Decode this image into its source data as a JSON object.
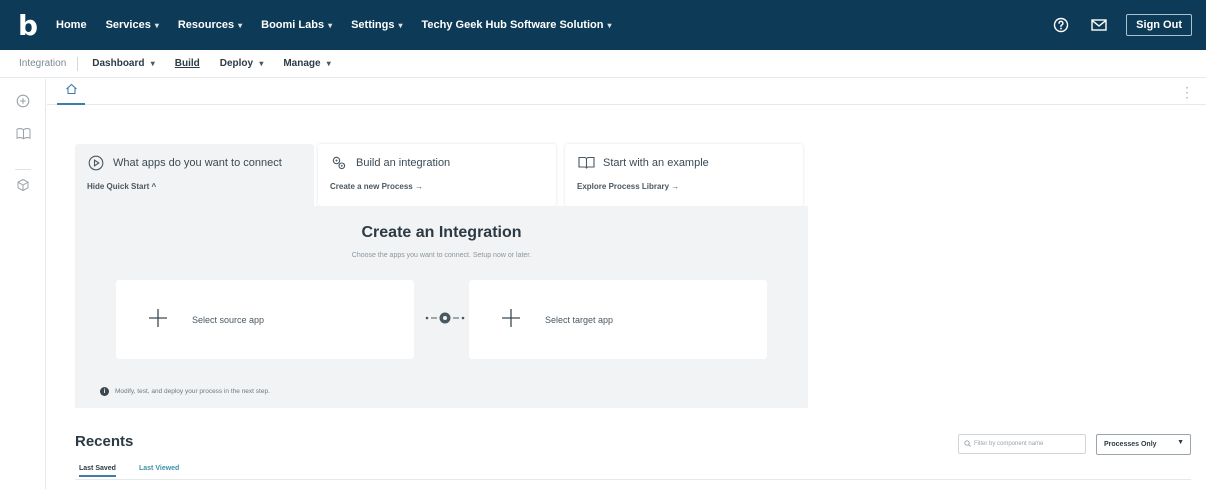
{
  "topnav": {
    "logo": "b",
    "items": [
      {
        "label": "Home",
        "caret": false
      },
      {
        "label": "Services",
        "caret": true
      },
      {
        "label": "Resources",
        "caret": true
      },
      {
        "label": "Boomi Labs",
        "caret": true
      },
      {
        "label": "Settings",
        "caret": true
      },
      {
        "label": "Techy Geek Hub Software Solution",
        "caret": true
      }
    ],
    "help_icon": "question-circle-icon",
    "mail_icon": "mail-icon",
    "signout_label": "Sign Out",
    "bg_color": "#0d3a56"
  },
  "subnav": {
    "title": "Integration",
    "items": [
      {
        "label": "Dashboard",
        "caret": true
      },
      {
        "label": "Build",
        "caret": false
      },
      {
        "label": "Deploy",
        "caret": true
      },
      {
        "label": "Manage",
        "caret": true
      }
    ]
  },
  "leftrail": {
    "icons": [
      "add-circle-icon",
      "book-icon",
      "component-icon"
    ]
  },
  "tabbar": {
    "home_icon": "home-icon",
    "menu_icon": "kebab-menu-icon"
  },
  "cards": [
    {
      "title": "What apps do you want to connect",
      "link": "Hide Quick Start",
      "link_arrow": "^",
      "icon": "play-circle-icon",
      "active": true
    },
    {
      "title": "Build an integration",
      "link": "Create a new Process",
      "link_arrow": "→",
      "icon": "gears-icon",
      "active": false
    },
    {
      "title": "Start with an example",
      "link": "Explore Process Library",
      "link_arrow": "→",
      "icon": "open-book-icon",
      "active": false
    }
  ],
  "panel": {
    "title": "Create an Integration",
    "subtitle": "Choose the apps you want to connect. Setup now or later.",
    "source_label": "Select source app",
    "target_label": "Select target app",
    "note": "Modify, test, and deploy your process in the next step."
  },
  "recents": {
    "title": "Recents",
    "tabs": [
      {
        "label": "Last Saved",
        "active": true
      },
      {
        "label": "Last Viewed",
        "active": false
      }
    ],
    "filter_placeholder": "Filter by component name",
    "select_value": "Processes Only",
    "accent_color": "#3b7ea8"
  }
}
